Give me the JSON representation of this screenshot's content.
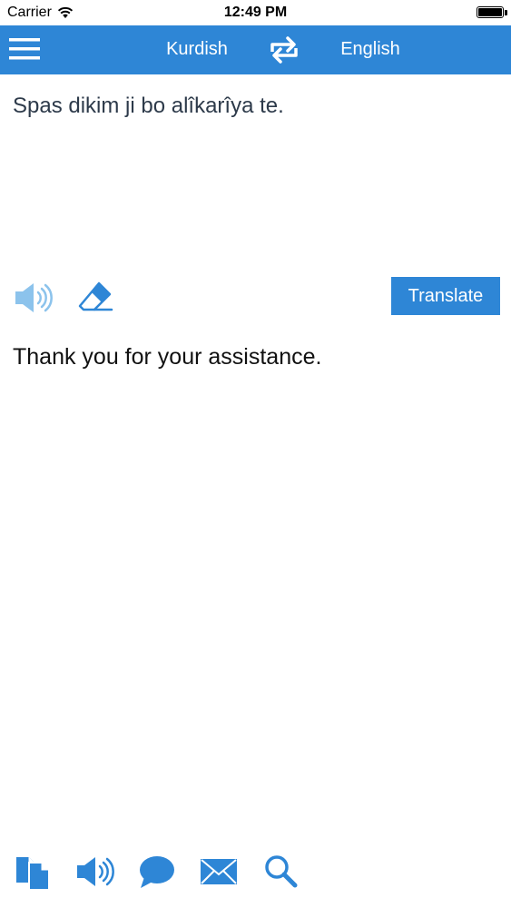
{
  "status_bar": {
    "carrier": "Carrier",
    "time": "12:49 PM"
  },
  "nav": {
    "source_language": "Kurdish",
    "target_language": "English"
  },
  "source": {
    "text": "Spas dikim ji bo alîkarîya te."
  },
  "controls": {
    "translate_label": "Translate"
  },
  "result": {
    "text": "Thank you for your assistance."
  },
  "theme": {
    "accent": "#2e86d6",
    "light_accent": "#8cc3ec"
  },
  "toolbar": {
    "icons": [
      "copy-icon",
      "speaker-icon",
      "chat-bubble-icon",
      "mail-icon",
      "search-icon"
    ]
  }
}
